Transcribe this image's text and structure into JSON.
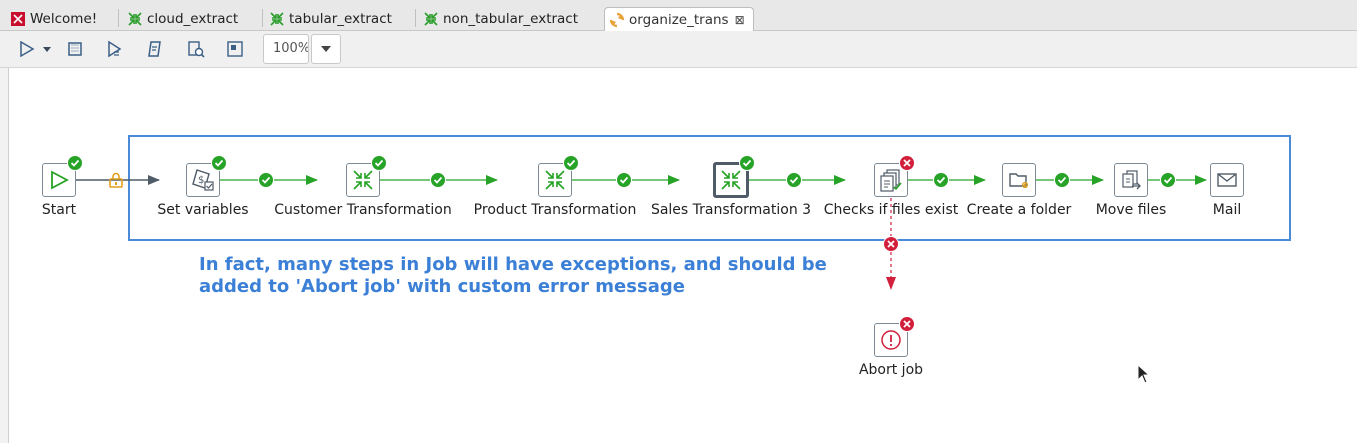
{
  "tabs": [
    {
      "label": "Welcome!",
      "icon": "spoon-icon",
      "active": false
    },
    {
      "label": "cloud_extract",
      "icon": "transformation-icon",
      "active": false
    },
    {
      "label": "tabular_extract",
      "icon": "transformation-icon",
      "active": false
    },
    {
      "label": "non_tabular_extract",
      "icon": "transformation-icon",
      "active": false
    },
    {
      "label": "organize_trans",
      "icon": "job-icon",
      "active": true
    }
  ],
  "toolbar": {
    "zoom_value": "100%",
    "buttons": [
      "run-icon",
      "run-options-icon",
      "stop-icon",
      "preview-icon",
      "debug-icon",
      "replay-icon",
      "check-icon",
      "impact-icon"
    ]
  },
  "job": {
    "entries": [
      {
        "id": "start",
        "label": "Start"
      },
      {
        "id": "set-variables",
        "label": "Set variables"
      },
      {
        "id": "customer-transformation",
        "label": "Customer Transformation"
      },
      {
        "id": "product-transformation",
        "label": "Product Transformation"
      },
      {
        "id": "sales-transformation-3",
        "label": "Sales Transformation 3"
      },
      {
        "id": "checks-if-files-exist",
        "label": "Checks if files exist"
      },
      {
        "id": "create-a-folder",
        "label": "Create a folder"
      },
      {
        "id": "move-files",
        "label": "Move files"
      },
      {
        "id": "mail",
        "label": "Mail"
      },
      {
        "id": "abort-job",
        "label": "Abort job"
      }
    ],
    "note": "In fact, many steps in Job will have exceptions, and should be added to 'Abort job' with custom error message"
  },
  "colors": {
    "ok": "#27a327",
    "error": "#d21f3c",
    "note": "#3b80d6",
    "selection": "#4a8ad6",
    "lock": "#e0a020"
  }
}
